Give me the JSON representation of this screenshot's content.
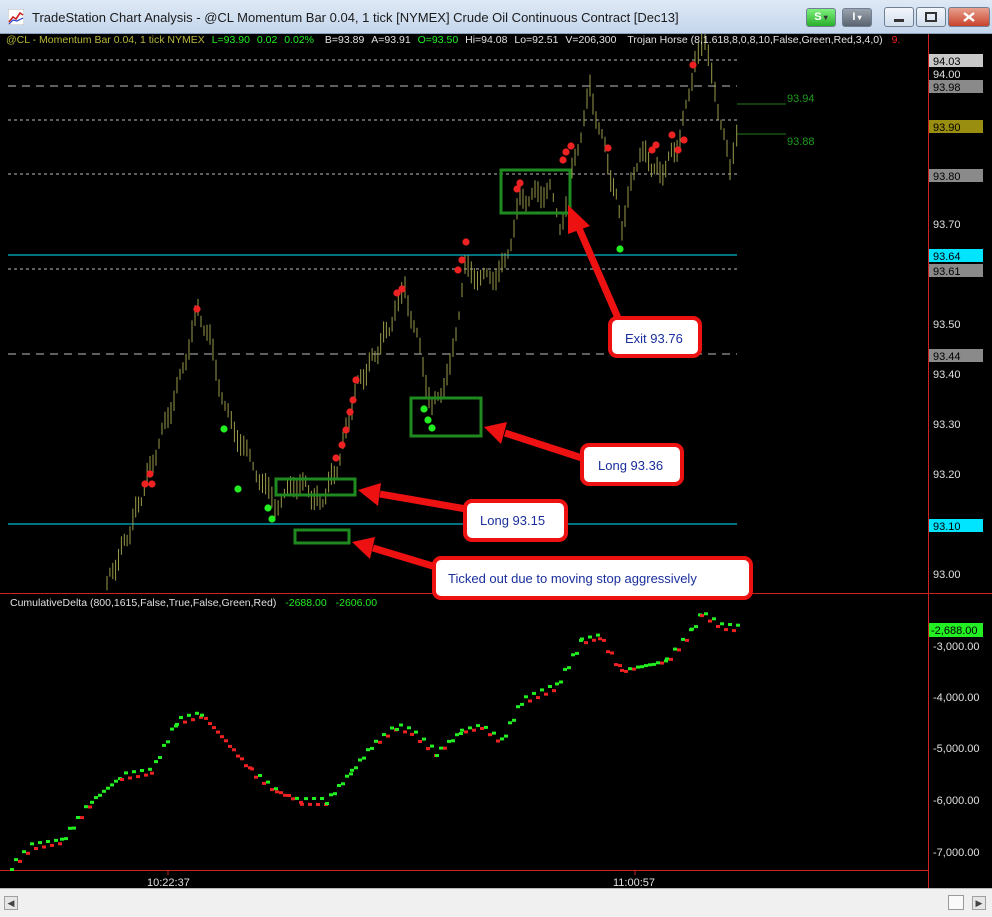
{
  "window": {
    "title": "TradeStation Chart Analysis - @CL Momentum Bar 0.04, 1 tick [NYMEX] Crude Oil Continuous Contract [Dec13]",
    "s_button": "S",
    "menu_button": "I",
    "controls": [
      "minimize",
      "restore",
      "close"
    ]
  },
  "price_header": {
    "symbol": "@CL - Momentum Bar 0.04, 1 tick",
    "exchange": "NYMEX",
    "last": "L=93.90",
    "change": "0.02",
    "change_pct": "0.02%",
    "bid": "B=93.89",
    "ask": "A=93.91",
    "open": "O=93.50",
    "high": "Hi=94.08",
    "low": "Lo=92.51",
    "volume": "V=206,300",
    "indicator": "Trojan Horse (8,1.618,8,0,8,10,False,Green,Red,3,4,0)",
    "indicator_tail": "9."
  },
  "indicator_header": {
    "name": "CumulativeDelta (800,1615,False,True,False,Green,Red)",
    "value1": "-2688.00",
    "value2": "-2606.00"
  },
  "price_axis": {
    "ticks": [
      "93.70",
      "93.50",
      "93.40",
      "93.30",
      "93.20",
      "93.00"
    ],
    "labels": [
      {
        "text": "94.03",
        "bg": "#c8c8c8"
      },
      {
        "text": "94.00",
        "bg": "#000000"
      },
      {
        "text": "93.98",
        "bg": "#8a8a8a"
      },
      {
        "text": "93.90",
        "bg": "#9a8e10"
      },
      {
        "text": "93.80",
        "bg": "#8a8a8a"
      },
      {
        "text": "93.64",
        "bg": "#00e5ff"
      },
      {
        "text": "93.61",
        "bg": "#8a8a8a"
      },
      {
        "text": "93.44",
        "bg": "#8a8a8a"
      },
      {
        "text": "93.10",
        "bg": "#00e5ff"
      }
    ],
    "line_labels": [
      "93.94",
      "93.88"
    ]
  },
  "delta_axis": {
    "ticks": [
      "-3,000.00",
      "-4,000.00",
      "-5,000.00",
      "-6,000.00",
      "-7,000.00"
    ],
    "current": "-2,688.00"
  },
  "time_axis": [
    "10:22:37",
    "11:00:57"
  ],
  "annotations": {
    "exit": "Exit 93.76",
    "long2": "Long 93.36",
    "long1": "Long 93.15",
    "ticked": "Ticked out due to moving stop aggressively"
  },
  "colors": {
    "bars": "#9a9a4a",
    "up": "#22ee22",
    "down": "#ee2222",
    "cyan": "#00e5ff",
    "box": "#1f8a1f",
    "arrow": "#ee1111"
  }
}
